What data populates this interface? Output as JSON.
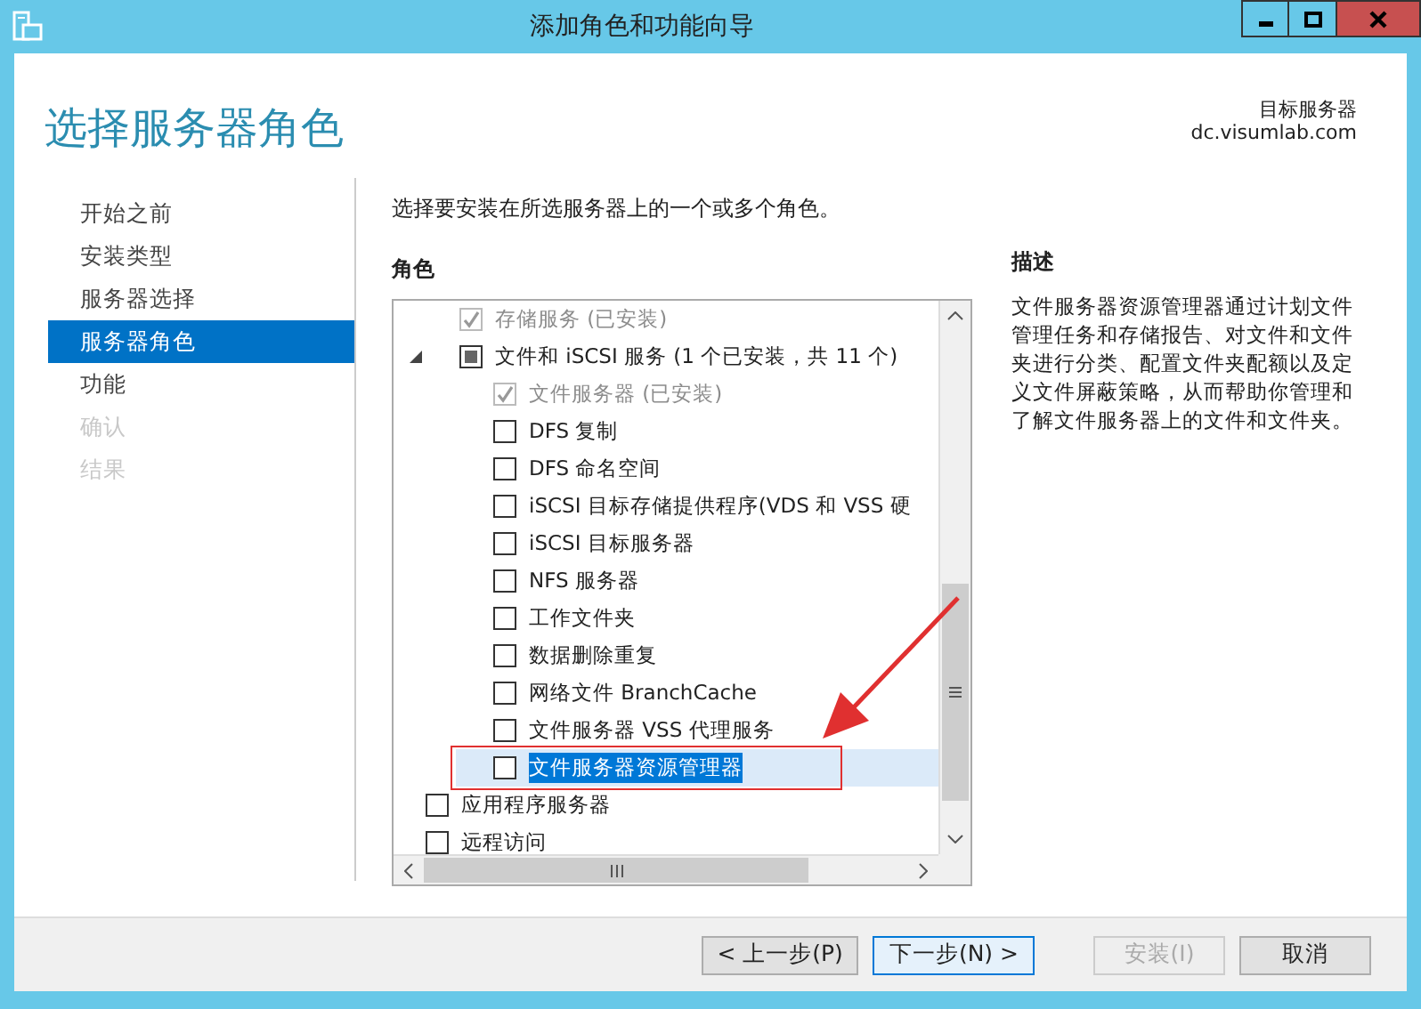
{
  "window": {
    "title": "添加角色和功能向导"
  },
  "header": {
    "title": "选择服务器角色",
    "target_label": "目标服务器",
    "target_server": "dc.visumlab.com"
  },
  "steps": [
    {
      "label": "开始之前",
      "selected": false,
      "disabled": false
    },
    {
      "label": "安装类型",
      "selected": false,
      "disabled": false
    },
    {
      "label": "服务器选择",
      "selected": false,
      "disabled": false
    },
    {
      "label": "服务器角色",
      "selected": true,
      "disabled": false
    },
    {
      "label": "功能",
      "selected": false,
      "disabled": false
    },
    {
      "label": "确认",
      "selected": false,
      "disabled": true
    },
    {
      "label": "结果",
      "selected": false,
      "disabled": true
    }
  ],
  "instruction": "选择要安装在所选服务器上的一个或多个角色。",
  "roles": {
    "heading": "角色",
    "items": [
      {
        "kind": "group",
        "children": [
          {
            "kind": "role",
            "label": "存储服务 (已安装)",
            "checked": true,
            "indeterminate": false,
            "disabled": true,
            "selected": false
          },
          {
            "kind": "role",
            "label": "文件和 iSCSI 服务 (1 个已安装，共 11 个)",
            "checked": false,
            "indeterminate": true,
            "disabled": false,
            "selected": false,
            "expanded": true,
            "children": [
              {
                "kind": "role",
                "label": "文件服务器 (已安装)",
                "checked": true,
                "indeterminate": false,
                "disabled": true,
                "selected": false
              },
              {
                "kind": "role",
                "label": "DFS 复制",
                "checked": false,
                "indeterminate": false,
                "disabled": false,
                "selected": false
              },
              {
                "kind": "role",
                "label": "DFS 命名空间",
                "checked": false,
                "indeterminate": false,
                "disabled": false,
                "selected": false
              },
              {
                "kind": "role",
                "label": "iSCSI 目标存储提供程序(VDS 和 VSS 硬",
                "checked": false,
                "indeterminate": false,
                "disabled": false,
                "selected": false
              },
              {
                "kind": "role",
                "label": "iSCSI 目标服务器",
                "checked": false,
                "indeterminate": false,
                "disabled": false,
                "selected": false
              },
              {
                "kind": "role",
                "label": "NFS 服务器",
                "checked": false,
                "indeterminate": false,
                "disabled": false,
                "selected": false
              },
              {
                "kind": "role",
                "label": "工作文件夹",
                "checked": false,
                "indeterminate": false,
                "disabled": false,
                "selected": false
              },
              {
                "kind": "role",
                "label": "数据删除重复",
                "checked": false,
                "indeterminate": false,
                "disabled": false,
                "selected": false
              },
              {
                "kind": "role",
                "label": "网络文件 BranchCache",
                "checked": false,
                "indeterminate": false,
                "disabled": false,
                "selected": false
              },
              {
                "kind": "role",
                "label": "文件服务器 VSS 代理服务",
                "checked": false,
                "indeterminate": false,
                "disabled": false,
                "selected": false
              },
              {
                "kind": "role",
                "label": "文件服务器资源管理器",
                "checked": false,
                "indeterminate": false,
                "disabled": false,
                "selected": true
              }
            ]
          }
        ]
      },
      {
        "kind": "role",
        "label": "应用程序服务器",
        "checked": false,
        "indeterminate": false,
        "disabled": false,
        "selected": false
      },
      {
        "kind": "role",
        "label": "远程访问",
        "checked": false,
        "indeterminate": false,
        "disabled": false,
        "selected": false
      }
    ]
  },
  "description": {
    "heading": "描述",
    "text": "文件服务器资源管理器通过计划文件管理任务和存储报告、对文件和文件夹进行分类、配置文件夹配额以及定义文件屏蔽策略，从而帮助你管理和了解文件服务器上的文件和文件夹。"
  },
  "buttons": [
    {
      "label": "< 上一步(P)",
      "disabled": false,
      "default": false
    },
    {
      "label": "下一步(N) >",
      "disabled": false,
      "default": true
    },
    {
      "label": "安装(I)",
      "disabled": true,
      "default": false
    },
    {
      "label": "取消",
      "disabled": false,
      "default": false
    }
  ]
}
